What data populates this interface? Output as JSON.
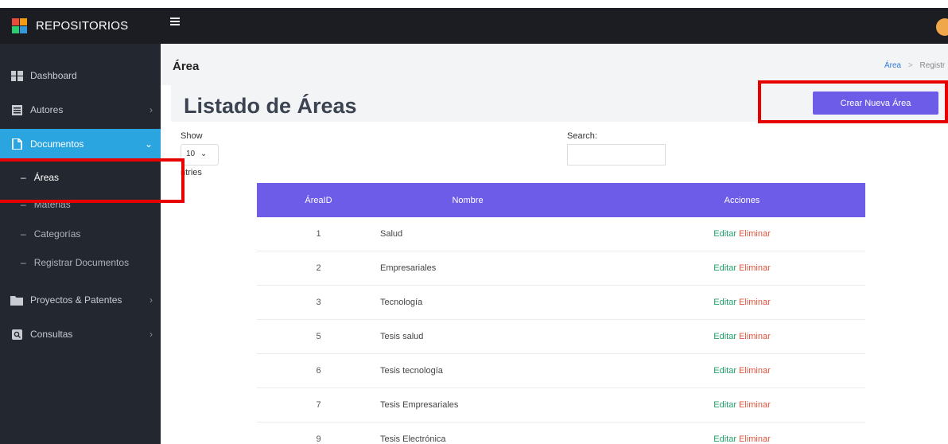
{
  "brand": {
    "title": "REPOSITORIOS",
    "logo_colors": [
      "#e74c3c",
      "#f39c12",
      "#2ecc71",
      "#3498db"
    ]
  },
  "sidebar": {
    "items": [
      {
        "label": "Dashboard",
        "icon": "dashboard-icon"
      },
      {
        "label": "Autores",
        "icon": "list-icon"
      },
      {
        "label": "Documentos",
        "icon": "document-icon",
        "active": true
      },
      {
        "label": "Proyectos & Patentes",
        "icon": "folder-icon"
      },
      {
        "label": "Consultas",
        "icon": "search-icon"
      }
    ],
    "subitems": [
      "Áreas",
      "Materias",
      "Categorías",
      "Registrar Documentos"
    ],
    "active_color": "#2ba5e0"
  },
  "header": {
    "title": "Área",
    "breadcrumb": [
      "Área",
      "Registr"
    ]
  },
  "main": {
    "page_title": "Listado de Áreas",
    "create_button": "Crear Nueva Área",
    "accent": "#6c5ce7"
  },
  "table_controls": {
    "show_label": "Show",
    "length_value": "10",
    "entries_label": "ntries",
    "search_label": "Search:"
  },
  "table": {
    "columns": [
      "ÁreaID",
      "Nombre",
      "Acciones"
    ],
    "rows": [
      {
        "id": "1",
        "name": "Salud"
      },
      {
        "id": "2",
        "name": "Empresariales"
      },
      {
        "id": "3",
        "name": "Tecnología"
      },
      {
        "id": "5",
        "name": "Tesis salud"
      },
      {
        "id": "6",
        "name": "Tesis tecnología"
      },
      {
        "id": "7",
        "name": "Tesis Empresariales"
      },
      {
        "id": "9",
        "name": "Tesis Electrónica"
      }
    ],
    "edit_label": "Editar",
    "delete_label": "Eliminar"
  }
}
